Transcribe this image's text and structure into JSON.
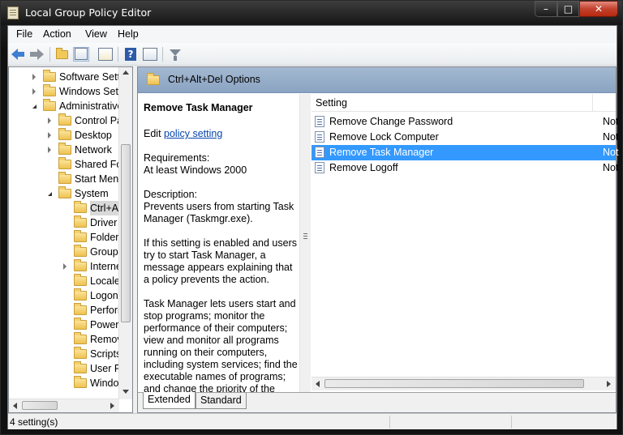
{
  "window": {
    "title": "Local Group Policy Editor",
    "controls": {
      "minimize": "–",
      "maximize": "□",
      "close": "✕"
    }
  },
  "menubar": [
    "File",
    "Action",
    "View",
    "Help"
  ],
  "toolbar": {
    "icons": [
      "back-arrow-icon",
      "forward-arrow-icon",
      "up-folder-icon",
      "show-hide-tree-icon",
      "export-list-icon",
      "help-icon",
      "properties-pane-icon",
      "filter-icon"
    ]
  },
  "tree": [
    {
      "label": "Software Setti",
      "expander": "closed"
    },
    {
      "label": "Windows Sett",
      "expander": "closed"
    },
    {
      "label": "Administrative",
      "expander": "open"
    },
    {
      "label": "Control Pa",
      "expander": "closed"
    },
    {
      "label": "Desktop",
      "expander": "closed"
    },
    {
      "label": "Network",
      "expander": "closed"
    },
    {
      "label": "Shared Fol",
      "expander": "none"
    },
    {
      "label": "Start Menu",
      "expander": "none"
    },
    {
      "label": "System",
      "expander": "open"
    },
    {
      "label": "Ctrl+A",
      "expander": "none",
      "selected": true
    },
    {
      "label": "Driver I",
      "expander": "none"
    },
    {
      "label": "Folder",
      "expander": "none"
    },
    {
      "label": "Group",
      "expander": "none"
    },
    {
      "label": "Interne",
      "expander": "closed"
    },
    {
      "label": "Locale",
      "expander": "none"
    },
    {
      "label": "Logon",
      "expander": "none"
    },
    {
      "label": "Perfori",
      "expander": "none"
    },
    {
      "label": "Power",
      "expander": "none"
    },
    {
      "label": "Remov",
      "expander": "none"
    },
    {
      "label": "Scripts",
      "expander": "none"
    },
    {
      "label": "User Pr",
      "expander": "none"
    },
    {
      "label": "Windo",
      "expander": "none"
    }
  ],
  "header": {
    "title": "Ctrl+Alt+Del Options"
  },
  "description": {
    "heading": "Remove Task Manager",
    "edit_prefix": "Edit ",
    "edit_link": "policy setting",
    "requirements_label": "Requirements:",
    "requirements_value": "At least Windows 2000",
    "description_label": "Description:",
    "description_text": "Prevents users from starting Task Manager (Taskmgr.exe).",
    "para2": "If this setting is enabled and users try to start Task Manager, a message appears explaining that a policy prevents the action.",
    "para3": "Task Manager lets users start and stop programs; monitor the performance of their computers; view and monitor all programs running on their computers, including system services; find the executable names of programs; and change the priority of the"
  },
  "list": {
    "column_setting": "Setting",
    "rows": [
      {
        "name": "Remove Change Password",
        "state": "Not"
      },
      {
        "name": "Remove Lock Computer",
        "state": "Not"
      },
      {
        "name": "Remove Task Manager",
        "state": "Not",
        "selected": true
      },
      {
        "name": "Remove Logoff",
        "state": "Not"
      }
    ]
  },
  "tabs": [
    "Extended",
    "Standard"
  ],
  "active_tab": "Extended",
  "status": {
    "text": "4 setting(s)"
  },
  "colors": {
    "selection": "#3399ff",
    "header_strip": "#8aa3c2",
    "link": "#0645ad"
  }
}
